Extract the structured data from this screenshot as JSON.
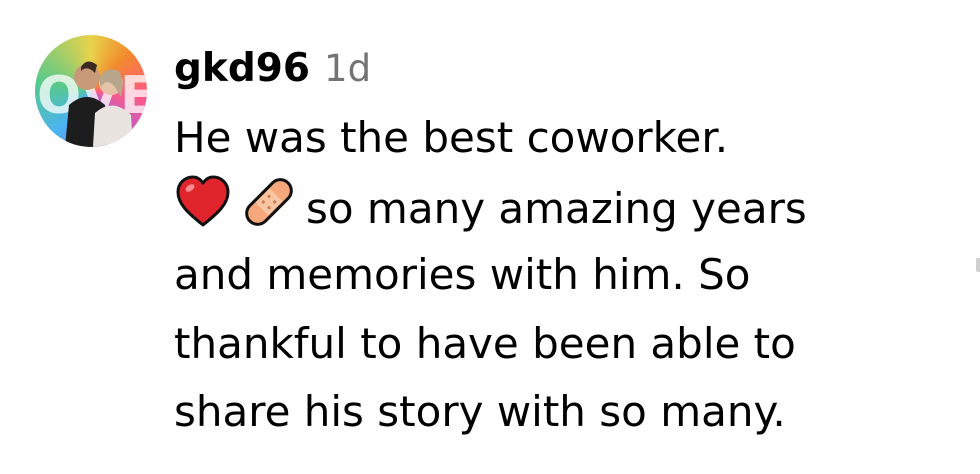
{
  "comment": {
    "username": "gkd96",
    "timestamp": "1d",
    "lines": [
      "He was the best coworker.",
      "so many amazing years",
      "and memories with him. So",
      "thankful to have been able to",
      "share his story with so many."
    ],
    "emojis": [
      "red-heart",
      "adhesive-bandage"
    ],
    "avatar_text": "OVE"
  },
  "colors": {
    "text": "#000000",
    "timestamp": "#737373",
    "heart": "#e0242c",
    "bandage": "#f6a77b"
  }
}
